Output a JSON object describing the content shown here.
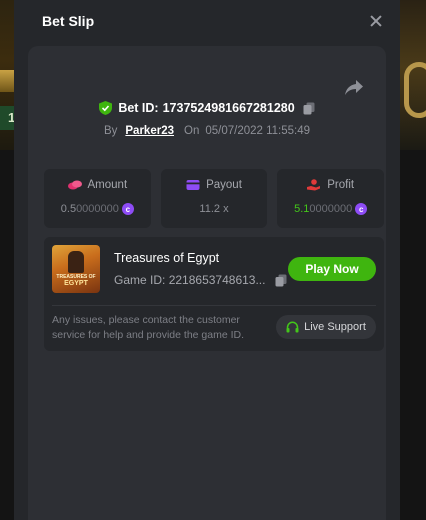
{
  "modal": {
    "title": "Bet Slip"
  },
  "bet": {
    "id_label": "Bet ID:",
    "id_value": "1737524981667281280",
    "by_label": "By",
    "user": "Parker23",
    "on_label": "On",
    "datetime": "05/07/2022 11:55:49"
  },
  "stats": {
    "amount": {
      "label": "Amount",
      "value_main": "0.5",
      "value_trailing": "0000000"
    },
    "payout": {
      "label": "Payout",
      "value": "11.2 x"
    },
    "profit": {
      "label": "Profit",
      "value_main": "5.1",
      "value_trailing": "0000000"
    }
  },
  "game": {
    "title": "Treasures of Egypt",
    "id_label": "Game ID:",
    "id_value": "2218653748613...",
    "thumb_line1": "TREASURES OF",
    "thumb_line2": "EGYPT",
    "play_label": "Play Now",
    "notice": "Any issues, please contact the customer service for help and provide the game ID.",
    "support_label": "Live Support"
  },
  "backdrop": {
    "left_badge": "1"
  },
  "colors": {
    "accent_green": "#3fb50f",
    "profit_green": "#43c61a",
    "coin_purple": "#8e4cf6",
    "amount_pink": "#e0316f",
    "payout_purple": "#8e4cf6",
    "profit_red": "#e03a3a"
  },
  "icons": [
    "close-icon",
    "share-icon",
    "shield-check-icon",
    "copy-icon",
    "coins-icon",
    "wallet-icon",
    "hand-coin-icon",
    "coin-icon",
    "headset-icon"
  ]
}
